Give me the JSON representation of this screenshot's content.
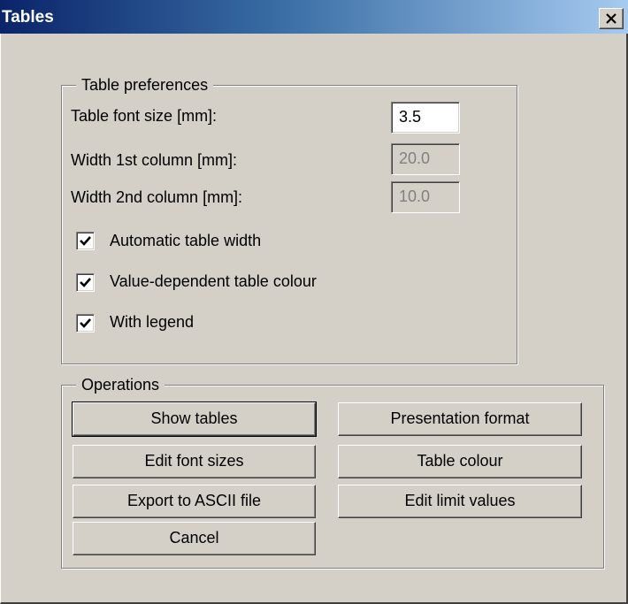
{
  "window": {
    "title": "Tables"
  },
  "preferences": {
    "legend": "Table preferences",
    "font_size_label": "Table font size [mm]:",
    "font_size_value": "3.5",
    "width1_label": "Width 1st column [mm]:",
    "width1_value": "20.0",
    "width2_label": "Width 2nd column [mm]:",
    "width2_value": "10.0",
    "checkboxes": [
      {
        "label": "Automatic table width",
        "checked": true
      },
      {
        "label": "Value-dependent table colour",
        "checked": true
      },
      {
        "label": "With legend",
        "checked": true
      }
    ]
  },
  "operations": {
    "legend": "Operations",
    "show_tables": "Show tables",
    "presentation_format": "Presentation format",
    "edit_font_sizes": "Edit font sizes",
    "table_colour": "Table colour",
    "export_ascii": "Export to ASCII file",
    "edit_limit_values": "Edit limit values",
    "cancel": "Cancel"
  }
}
